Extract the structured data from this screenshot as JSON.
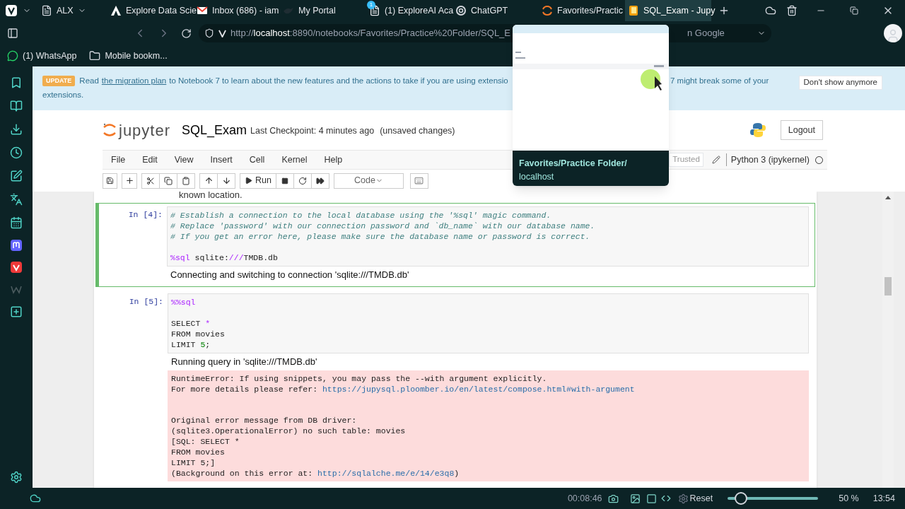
{
  "browser": {
    "tabs": [
      {
        "title": "ALX",
        "kind": "group",
        "selected": false
      },
      {
        "title": "Explore Data Scie",
        "kind": "triangle",
        "selected": false
      },
      {
        "title": "Inbox (686) - iam",
        "kind": "mail",
        "selected": false
      },
      {
        "title": "My Portal",
        "kind": "bird",
        "selected": false
      },
      {
        "title": "(1) ExploreAI Aca",
        "kind": "doc",
        "badge": "1",
        "selected": false
      },
      {
        "title": "ChatGPT",
        "kind": "knot",
        "selected": false
      },
      {
        "title": "Favorites/Practic",
        "kind": "ring",
        "selected": false
      },
      {
        "title": "SQL_Exam - Jupy",
        "kind": "book",
        "selected": true
      }
    ],
    "url_scheme": "http://",
    "url_host": "localhost",
    "url_path": ":8890/notebooks/Favorites/Practice%20Folder/SQL_E",
    "url_tail": "n Google",
    "bookmarks": [
      {
        "label": "(1) WhatsApp",
        "kind": "whatsapp"
      },
      {
        "label": "Mobile bookm...",
        "kind": "folder"
      }
    ]
  },
  "tab_preview": {
    "title": "Favorites/Practice Folder/",
    "subtitle": "localhost"
  },
  "banner": {
    "badge": "UPDATE",
    "text_before": "Read",
    "link": "the migration plan",
    "text_after": "to Notebook 7 to learn about the new features and the actions to take if you are using extensio",
    "text_right": "7 might break some of your",
    "text_line2": "extensions.",
    "button": "Don't show anymore"
  },
  "notebook": {
    "logo_text": "jupyter",
    "name": "SQL_Exam",
    "checkpoint": "Last Checkpoint: 4 minutes ago",
    "autosave": "(unsaved changes)",
    "logout": "Logout",
    "menu": [
      "File",
      "Edit",
      "View",
      "Insert",
      "Cell",
      "Kernel",
      "Help"
    ],
    "trusted": "Trusted",
    "kernel": "Python 3 (ipykernel)",
    "kernel_busy": false,
    "run_label": "Run",
    "cell_type": "Code",
    "partial_text": "known location."
  },
  "cells": [
    {
      "prompt": "In [4]:",
      "selected": true,
      "blocks": [
        [
          [
            {
              "t": "# Establish a connection to the local database using the '%sql' magic command.",
              "kind": "comment"
            }
          ],
          [
            {
              "t": "# Replace 'password' with our connection password and `db_name` with our database name.",
              "kind": "comment"
            }
          ],
          [
            {
              "t": "# If you get an error here, please make sure the database name or password is correct.",
              "kind": "comment"
            }
          ]
        ],
        [
          [
            {
              "t": "%sql",
              "kind": "magic"
            },
            {
              "t": " sqlite:",
              "kind": "plain"
            },
            {
              "t": "///",
              "kind": "operator"
            },
            {
              "t": "TMDB.db",
              "kind": "plain"
            }
          ]
        ]
      ],
      "outputs": [
        {
          "kind": "stream",
          "text": "Connecting and switching to connection 'sqlite:///TMDB.db'"
        }
      ]
    },
    {
      "prompt": "In [5]:",
      "selected": false,
      "blocks": [
        [
          [
            {
              "t": "%%sql",
              "kind": "magic"
            }
          ]
        ],
        [
          [
            {
              "t": "SELECT ",
              "kind": "plain"
            },
            {
              "t": "*",
              "kind": "operator"
            }
          ],
          [
            {
              "t": "FROM movies",
              "kind": "plain"
            }
          ],
          [
            {
              "t": "LIMIT ",
              "kind": "plain"
            },
            {
              "t": "5",
              "kind": "number"
            },
            {
              "t": ";",
              "kind": "plain"
            }
          ]
        ]
      ],
      "outputs": [
        {
          "kind": "stream",
          "text": "Running query in 'sqlite:///TMDB.db'"
        },
        {
          "kind": "error",
          "blocks": [
            [
              [
                {
                  "t": "RuntimeError: If using snippets, you may pass the --with argument explicitly.",
                  "kind": "plain"
                }
              ],
              [
                {
                  "t": "For more details please refer: ",
                  "kind": "plain"
                },
                {
                  "t": "https://jupysql.ploomber.io/en/latest/compose.html#with-argument",
                  "kind": "link"
                }
              ]
            ],
            [
              [
                {
                  "t": "Original error message from DB driver:",
                  "kind": "plain"
                }
              ],
              [
                {
                  "t": "(sqlite3.OperationalError) no such table: movies",
                  "kind": "plain"
                }
              ],
              [
                {
                  "t": "[SQL: SELECT *",
                  "kind": "plain"
                }
              ],
              [
                {
                  "t": "FROM movies",
                  "kind": "plain"
                }
              ],
              [
                {
                  "t": "LIMIT 5;]",
                  "kind": "plain"
                }
              ],
              [
                {
                  "t": "(Background on this error at: ",
                  "kind": "plain"
                },
                {
                  "t": "http://sqlalche.me/e/14/e3q8",
                  "kind": "link"
                },
                {
                  "t": ")",
                  "kind": "plain"
                }
              ]
            ]
          ]
        }
      ]
    }
  ],
  "recorder": {
    "time": "00:08:46",
    "reset": "Reset",
    "slider": {
      "level": 0.15
    },
    "zoom": "50 %",
    "clock": "13:54"
  }
}
